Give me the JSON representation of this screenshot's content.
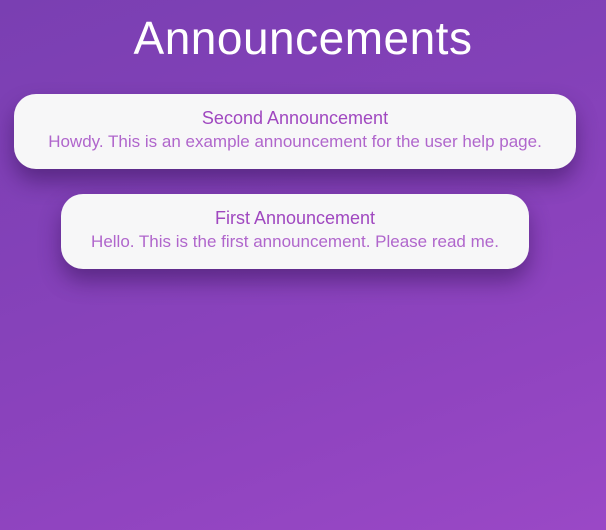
{
  "page": {
    "title": "Announcements"
  },
  "announcements": [
    {
      "title": "Second Announcement",
      "body": "Howdy. This is an example announcement for the user help page."
    },
    {
      "title": "First Announcement",
      "body": "Hello. This is the first announcement. Please read me."
    }
  ],
  "colors": {
    "background_start": "#7a3fb2",
    "background_end": "#9a48c6",
    "card_background": "#f7f7f8",
    "card_title": "#a048c0",
    "card_text": "#b066cc",
    "page_title": "#ffffff"
  }
}
